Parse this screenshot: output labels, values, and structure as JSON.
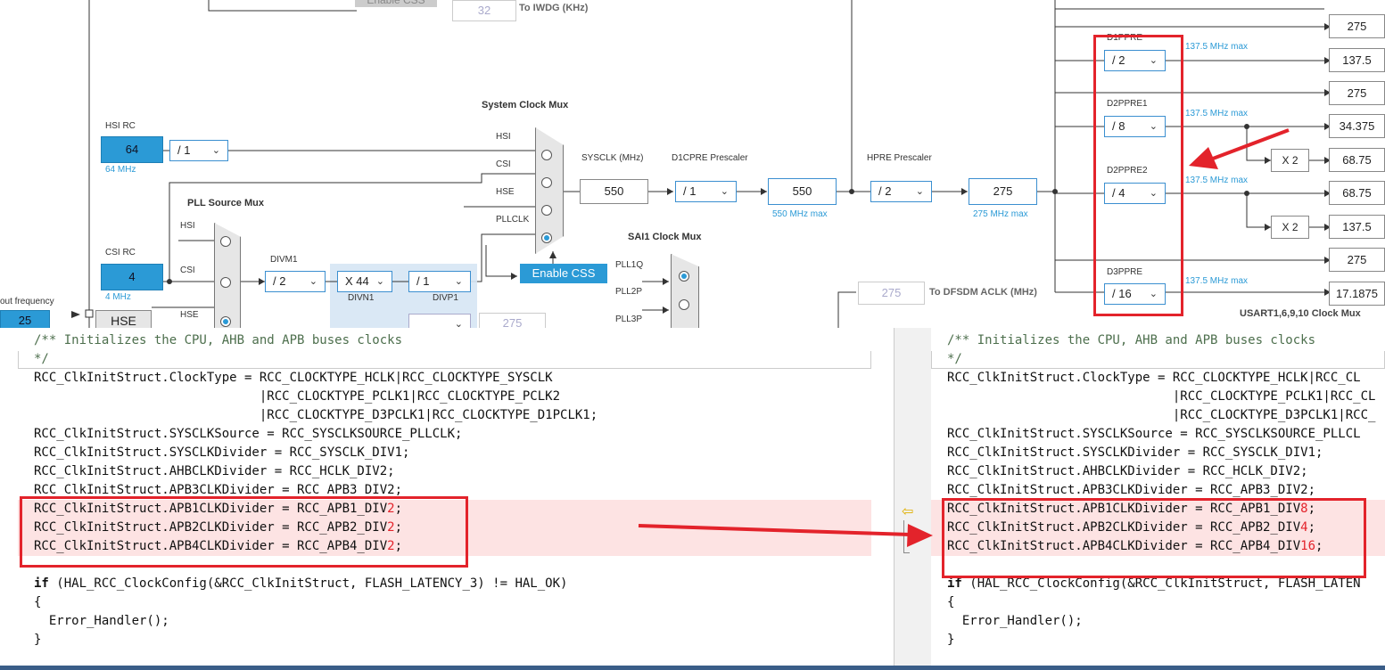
{
  "diagram": {
    "top_labels": {
      "enable_css_top": "Enable CSS",
      "iwdg_value": "32",
      "iwdg_label": "To IWDG (KHz)"
    },
    "hsi": {
      "title": "HSI RC",
      "value": "64",
      "freq": "64 MHz",
      "divider": "/ 1"
    },
    "csi": {
      "title": "CSI RC",
      "value": "4",
      "freq": "4 MHz"
    },
    "hse": {
      "label": "HSE",
      "input_freq_label": "out frequency",
      "input_value": "25"
    },
    "pll_mux": {
      "title": "PLL Source Mux",
      "in_hsi": "HSI",
      "in_csi": "CSI",
      "in_hse": "HSE"
    },
    "divm1": {
      "label": "DIVM1",
      "value": "/ 2"
    },
    "divn1": {
      "label": "DIVN1",
      "value": "X 44"
    },
    "divp1": {
      "label": "DIVP1",
      "value": "/ 1"
    },
    "pll_extra_value": "275",
    "sys_mux": {
      "title": "System Clock Mux",
      "in_hsi": "HSI",
      "in_csi": "CSI",
      "in_hse": "HSE",
      "in_pll": "PLLCLK"
    },
    "enable_css": "Enable CSS",
    "sai1": {
      "title": "SAI1 Clock Mux",
      "in1": "PLL1Q",
      "in2": "PLL2P",
      "in3": "PLL3P"
    },
    "sysclk": {
      "label": "SYSCLK (MHz)",
      "value": "550"
    },
    "d1cpre": {
      "label": "D1CPRE Prescaler",
      "value": "/ 1",
      "out": "550",
      "max": "550 MHz max"
    },
    "hpre": {
      "label": "HPRE Prescaler",
      "value": "/ 2",
      "out": "275",
      "max": "275 MHz max"
    },
    "dfsdm": {
      "value": "275",
      "label": "To DFSDM ACLK (MHz)"
    },
    "d1ppre": {
      "label": "D1PPRE",
      "value": "/ 2",
      "max": "137.5 MHz max"
    },
    "d2ppre1": {
      "label": "D2PPRE1",
      "value": "/ 8",
      "max": "137.5 MHz max"
    },
    "d2ppre2": {
      "label": "D2PPRE2",
      "value": "/ 4",
      "max": "137.5 MHz max"
    },
    "d3ppre": {
      "label": "D3PPRE",
      "value": "/ 16",
      "max": "137.5 MHz max"
    },
    "x2a": "X 2",
    "x2b": "X 2",
    "outputs": [
      "275",
      "137.5",
      "275",
      "34.375",
      "68.75",
      "68.75",
      "137.5",
      "275",
      "17.1875"
    ],
    "usart_label": "USART1,6,9,10 Clock Mux"
  },
  "left_code": {
    "lines": [
      {
        "t": "/** Initializes the CPU, AHB and APB buses clocks",
        "cls": "cm"
      },
      {
        "t": "*/",
        "cls": "cm"
      },
      {
        "t": "RCC_ClkInitStruct.ClockType = RCC_CLOCKTYPE_HCLK|RCC_CLOCKTYPE_SYSCLK",
        "cls": ""
      },
      {
        "t": "                              |RCC_CLOCKTYPE_PCLK1|RCC_CLOCKTYPE_PCLK2",
        "cls": ""
      },
      {
        "t": "                              |RCC_CLOCKTYPE_D3PCLK1|RCC_CLOCKTYPE_D1PCLK1;",
        "cls": ""
      },
      {
        "t": "RCC_ClkInitStruct.SYSCLKSource = RCC_SYSCLKSOURCE_PLLCLK;",
        "cls": ""
      },
      {
        "t": "RCC_ClkInitStruct.SYSCLKDivider = RCC_SYSCLK_DIV1;",
        "cls": ""
      },
      {
        "t": "RCC_ClkInitStruct.AHBCLKDivider = RCC_HCLK_DIV2;",
        "cls": ""
      },
      {
        "t": "RCC_ClkInitStruct.APB3CLKDivider = RCC_APB3_DIV2;",
        "cls": ""
      },
      {
        "t": "RCC_ClkInitStruct.APB1CLKDivider = RCC_APB1_DIV",
        "red": "2",
        "tail": ";",
        "cls": "hl"
      },
      {
        "t": "RCC_ClkInitStruct.APB2CLKDivider = RCC_APB2_DIV",
        "red": "2",
        "tail": ";",
        "cls": "hl"
      },
      {
        "t": "RCC_ClkInitStruct.APB4CLKDivider = RCC_APB4_DIV",
        "red": "2",
        "tail": ";",
        "cls": "hl"
      },
      {
        "t": "",
        "cls": ""
      },
      {
        "t": "if (HAL_RCC_ClockConfig(&RCC_ClkInitStruct, FLASH_LATENCY_3) != HAL_OK)",
        "cls": "if"
      },
      {
        "t": "{",
        "cls": ""
      },
      {
        "t": "  Error_Handler();",
        "cls": ""
      },
      {
        "t": "}",
        "cls": ""
      }
    ]
  },
  "right_code": {
    "lines": [
      {
        "t": "/** Initializes the CPU, AHB and APB buses clocks",
        "cls": "cm"
      },
      {
        "t": "*/",
        "cls": "cm"
      },
      {
        "t": "RCC_ClkInitStruct.ClockType = RCC_CLOCKTYPE_HCLK|RCC_CL",
        "cls": ""
      },
      {
        "t": "                              |RCC_CLOCKTYPE_PCLK1|RCC_CL",
        "cls": ""
      },
      {
        "t": "                              |RCC_CLOCKTYPE_D3PCLK1|RCC_",
        "cls": ""
      },
      {
        "t": "RCC_ClkInitStruct.SYSCLKSource = RCC_SYSCLKSOURCE_PLLCL",
        "cls": ""
      },
      {
        "t": "RCC_ClkInitStruct.SYSCLKDivider = RCC_SYSCLK_DIV1;",
        "cls": ""
      },
      {
        "t": "RCC_ClkInitStruct.AHBCLKDivider = RCC_HCLK_DIV2;",
        "cls": ""
      },
      {
        "t": "RCC_ClkInitStruct.APB3CLKDivider = RCC_APB3_DIV2;",
        "cls": ""
      },
      {
        "t": "RCC_ClkInitStruct.APB1CLKDivider = RCC_APB1_DIV",
        "red": "8",
        "tail": ";",
        "cls": "hl"
      },
      {
        "t": "RCC_ClkInitStruct.APB2CLKDivider = RCC_APB2_DIV",
        "red": "4",
        "tail": ";",
        "cls": "hl"
      },
      {
        "t": "RCC_ClkInitStruct.APB4CLKDivider = RCC_APB4_DIV",
        "red": "16",
        "tail": ";",
        "cls": "hl"
      },
      {
        "t": "",
        "cls": ""
      },
      {
        "t": "if (HAL_RCC_ClockConfig(&RCC_ClkInitStruct, FLASH_LATEN",
        "cls": "if"
      },
      {
        "t": "{",
        "cls": ""
      },
      {
        "t": "  Error_Handler();",
        "cls": ""
      },
      {
        "t": "}",
        "cls": ""
      }
    ]
  },
  "colors": {
    "accent": "#2b9ad6",
    "annotation_red": "#e3232b",
    "diff_highlight": "#fde3e3"
  }
}
